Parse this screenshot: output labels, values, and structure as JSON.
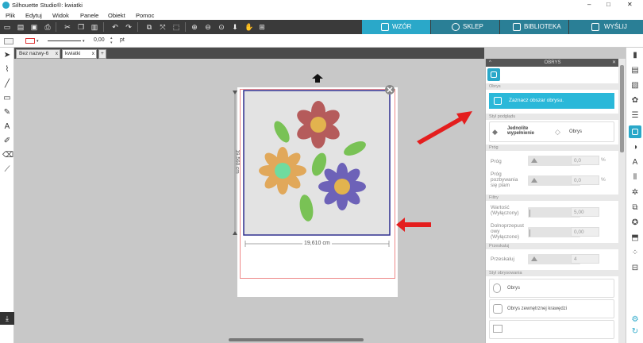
{
  "app": {
    "title": "Silhouette Studio®: kwiatki",
    "window_controls": [
      "–",
      "□",
      "✕"
    ]
  },
  "menu": [
    "Plik",
    "Edytuj",
    "Widok",
    "Panele",
    "Obiekt",
    "Pomoc"
  ],
  "top_tabs": [
    {
      "label": "WZÓR",
      "active": true
    },
    {
      "label": "SKLEP",
      "active": false
    },
    {
      "label": "BIBLIOTEKA",
      "active": false
    },
    {
      "label": "WYŚLIJ",
      "active": false
    }
  ],
  "options_bar": {
    "line_width": "0,00",
    "unit": "pt"
  },
  "doc_tabs": [
    {
      "label": "Bez nazwy-6",
      "close": "x"
    },
    {
      "label": "kwiatki",
      "close": "x"
    },
    {
      "label": "+"
    }
  ],
  "canvas": {
    "width_label": "19,610 cm",
    "height_label": "19,560 cm"
  },
  "panel": {
    "title": "OBRYS",
    "section_obrys": "Obrys",
    "select_area_button": "Zaznacz obszar obrysu.",
    "section_style": "Styl podglądu",
    "style_option_fill": "Jednolite wypełnienie",
    "style_option_outline": "Obrys",
    "section_threshold": "Próg",
    "threshold_label": "Próg",
    "threshold_value": "0,0",
    "threshold_unit": "%",
    "speckle_label": "Próg pozbywania się plam",
    "speckle_value": "0,0",
    "speckle_unit": "%",
    "section_filters": "Filtry",
    "highpass_label": "Wartość (Wyłączony)",
    "highpass_value": "5,00",
    "lowpass_label": "Dolnoprzepust owy (Wyłączone)",
    "lowpass_value": "0,00",
    "section_scale": "Przeskaluj",
    "scale_label": "Przeskaluj",
    "scale_value": "4",
    "section_apply": "Styl obrysowania",
    "apply_outline": "Obrys",
    "apply_outer_edge": "Obrys zewnętrznej krawędzi"
  },
  "colors": {
    "accent": "#2aa8c9",
    "toolbar": "#3a3a3a",
    "arrow": "#e41e1e",
    "petal_red": "#b55b5b",
    "petal_orange": "#e1a85a",
    "petal_purple": "#6d62b8",
    "center_gold": "#e2b34e",
    "center_mint": "#6fdb9f",
    "leaf_green": "#79c255"
  }
}
